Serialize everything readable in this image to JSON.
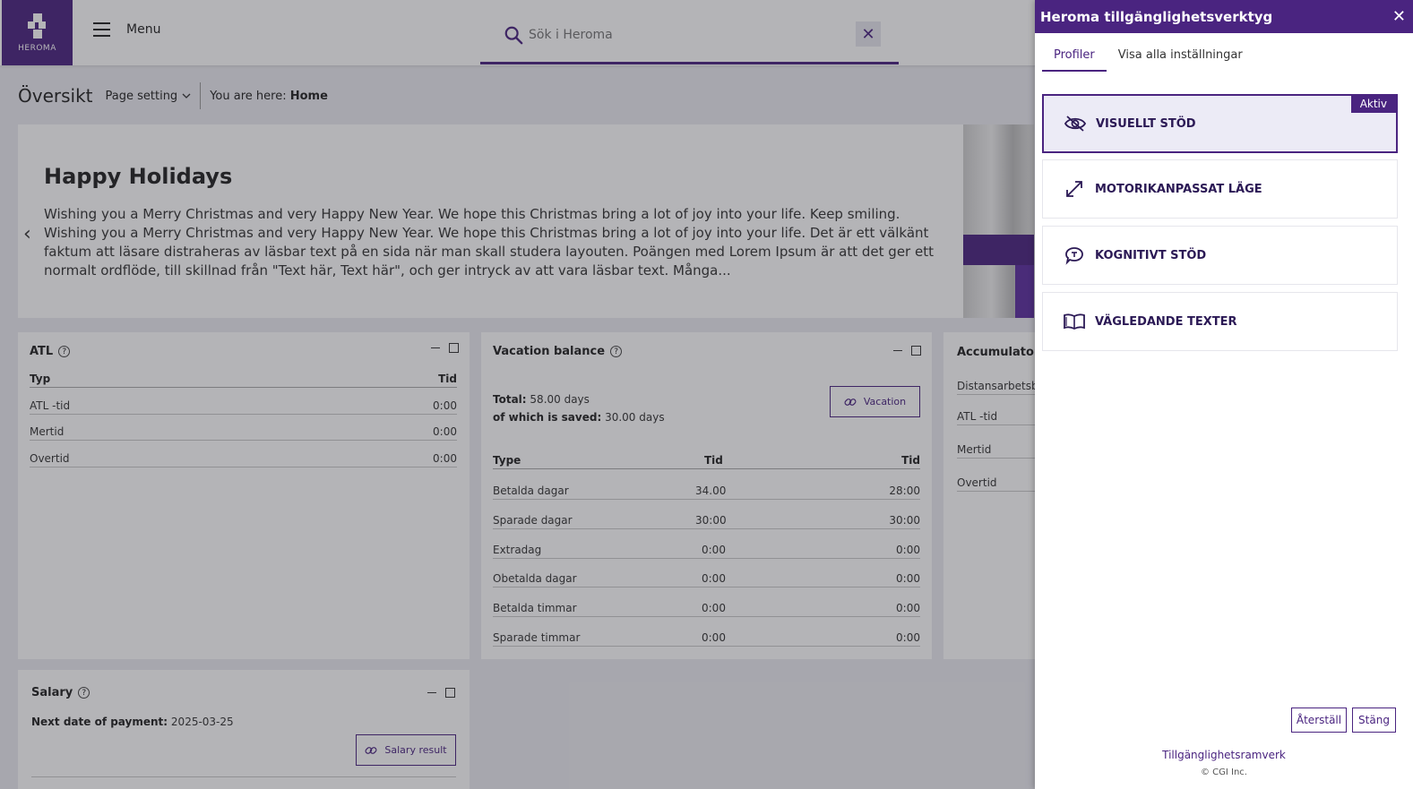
{
  "header": {
    "logo_text": "HEROMA",
    "menu_label": "Menu",
    "search_placeholder": "Sök i Heroma"
  },
  "titlebar": {
    "title": "Översikt",
    "page_setting": "Page setting",
    "crumb_prefix": "You are here:",
    "crumb_current": "Home"
  },
  "banner": {
    "title": "Happy Holidays",
    "text": "Wishing you a Merry Christmas and very Happy New Year. We hope this Christmas bring a lot of joy into your life. Keep smiling. Wishing you a Merry Christmas and very Happy New Year. We hope this Christmas bring a lot of joy into your life. Det är ett välkänt faktum att läsare distraheras av läsbar text på en sida när man skall studera layouten. Poängen med Lorem Ipsum är att det ger ett normalt ordflöde, till skillnad från \"Text här, Text här\", och ger intryck av att vara läsbar text. Många..."
  },
  "atl": {
    "title": "ATL",
    "col_type": "Typ",
    "col_time": "Tid",
    "rows": [
      {
        "type": "ATL -tid",
        "time": "0:00"
      },
      {
        "type": "Mertid",
        "time": "0:00"
      },
      {
        "type": "Overtid",
        "time": "0:00"
      }
    ]
  },
  "vacation": {
    "title": "Vacation balance",
    "total_label": "Total:",
    "total_value": "58.00 days",
    "saved_label": "of which is saved:",
    "saved_value": "30.00 days",
    "button": "Vacation",
    "col_type": "Type",
    "col_tid1": "Tid",
    "col_tid2": "Tid",
    "rows": [
      {
        "type": "Betalda dagar",
        "a": "34.00",
        "b": "28:00"
      },
      {
        "type": "Sparade dagar",
        "a": "30:00",
        "b": "30:00"
      },
      {
        "type": "Extradag",
        "a": "0:00",
        "b": "0:00"
      },
      {
        "type": "Obetalda dagar",
        "a": "0:00",
        "b": "0:00"
      },
      {
        "type": "Betalda timmar",
        "a": "0:00",
        "b": "0:00"
      },
      {
        "type": "Sparade timmar",
        "a": "0:00",
        "b": "0:00"
      }
    ]
  },
  "accumulators": {
    "title": "Accumulators",
    "rows": [
      "Distansarbetsbi",
      "ATL -tid",
      "Mertid",
      "Overtid"
    ]
  },
  "salary": {
    "title": "Salary",
    "next_label": "Next date of payment:",
    "next_value": "2025-03-25",
    "button": "Salary result"
  },
  "panel": {
    "title": "Heroma tillgänglighetsverktyg",
    "tabs": [
      "Profiler",
      "Visa alla inställningar"
    ],
    "active_badge": "Aktiv",
    "profiles": [
      {
        "label": "VISUELLT STÖD",
        "icon": "eye-slash-icon"
      },
      {
        "label": "MOTORIKANPASSAT LÄGE",
        "icon": "expand-arrows-icon"
      },
      {
        "label": "KOGNITIVT STÖD",
        "icon": "speech-bubble-icon"
      },
      {
        "label": "VÄGLEDANDE TEXTER",
        "icon": "open-book-icon"
      }
    ],
    "reset_label": "Återställ",
    "close_label": "Stäng",
    "footer_link": "Tillgänglighetsramverk",
    "copyright": "© CGI Inc."
  },
  "colors": {
    "brand": "#4a2480",
    "active_bg": "#ecebf6"
  }
}
